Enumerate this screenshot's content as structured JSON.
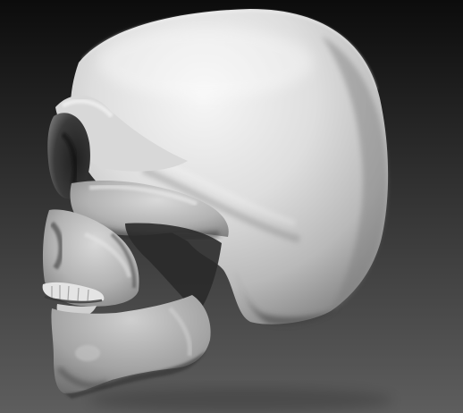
{
  "scene": {
    "subject": "skull-sculpt",
    "background_top": "#0c0c0c",
    "background_bottom": "#5e5e5e",
    "material_light": "#f3f3f3",
    "material_mid": "#bdbdbd",
    "material_dark": "#6a6a6a",
    "material_deep": "#2a2a2a"
  }
}
